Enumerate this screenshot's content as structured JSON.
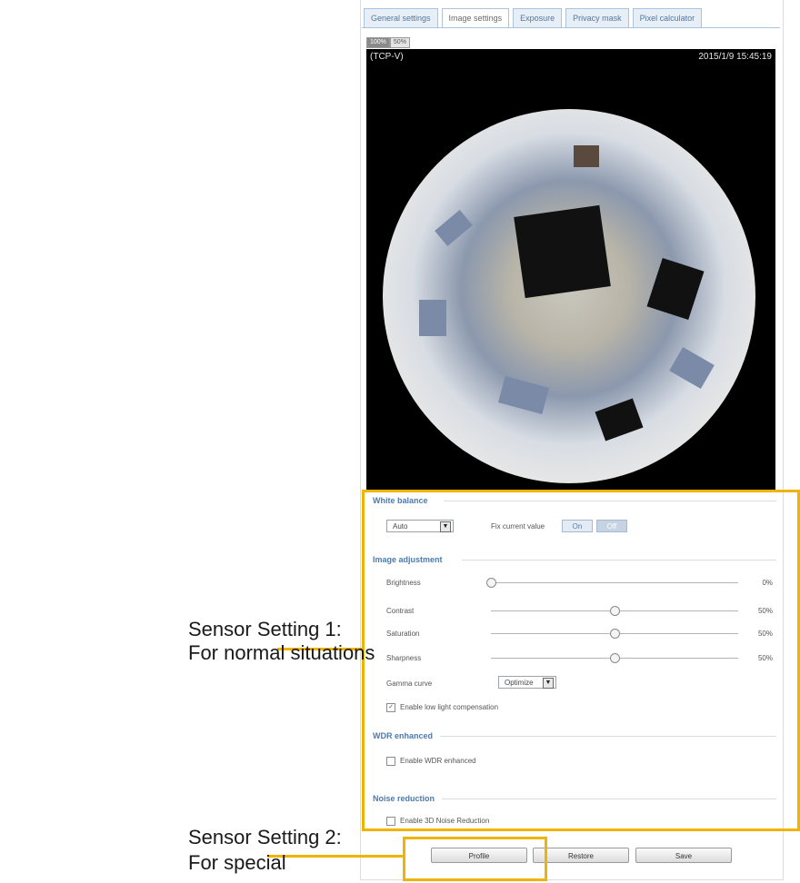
{
  "tabs": [
    "General settings",
    "Image settings",
    "Exposure",
    "Privacy mask",
    "Pixel calculator"
  ],
  "active_tab_index": 1,
  "view_sizes": [
    "100%",
    "50%"
  ],
  "video": {
    "protocol": "(TCP-V)",
    "timestamp": "2015/1/9 15:45:19"
  },
  "white_balance": {
    "title": "White balance",
    "mode_value": "Auto",
    "fix_label": "Fix current value",
    "on_label": "On",
    "off_label": "Off",
    "selected": "Off"
  },
  "image_adjustment": {
    "title": "Image adjustment",
    "sliders": [
      {
        "label": "Brightness",
        "value": "0%",
        "level": 0
      },
      {
        "label": "Contrast",
        "value": "50%",
        "level": 50
      },
      {
        "label": "Saturation",
        "value": "50%",
        "level": 50
      },
      {
        "label": "Sharpness",
        "value": "50%",
        "level": 50
      }
    ],
    "gamma_label": "Gamma curve",
    "gamma_value": "Optimize",
    "lowlight_label": "Enable low light compensation",
    "lowlight_checked": true
  },
  "wdr": {
    "title": "WDR enhanced",
    "checkbox_label": "Enable WDR enhanced",
    "checked": false
  },
  "noise": {
    "title": "Noise reduction",
    "checkbox_label": "Enable 3D Noise Reduction",
    "checked": false
  },
  "buttons": {
    "profile": "Profile",
    "restore": "Restore",
    "save": "Save"
  },
  "callouts": {
    "sensor1_line1": "Sensor Setting 1:",
    "sensor1_line2": "For normal situations",
    "sensor2_line1": "Sensor Setting 2:",
    "sensor2_line2": "For special"
  },
  "colors": {
    "highlight": "#f0b400",
    "section_title": "#4a7bb0",
    "tab_border": "#aac4dc"
  }
}
